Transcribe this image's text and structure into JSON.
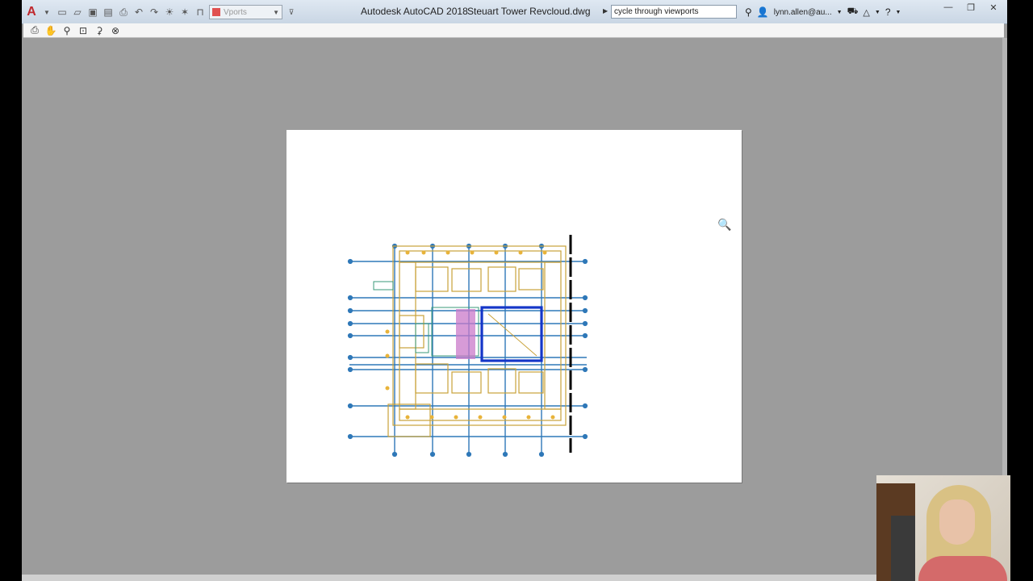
{
  "titlebar": {
    "app_title": "Autodesk AutoCAD 2018",
    "doc_title": "Steuart Tower Revcloud.dwg",
    "layer_dropdown": "Vports",
    "search_value": "cycle through viewports",
    "user": "lynn.allen@au..."
  },
  "toolbar": {
    "buttons": [
      "plot",
      "pan",
      "zoom-realtime",
      "zoom-window",
      "zoom-original",
      "close-preview"
    ]
  },
  "colors": {
    "background": "#9c9c9c",
    "paper": "#ffffff",
    "accent": "#e05050"
  }
}
